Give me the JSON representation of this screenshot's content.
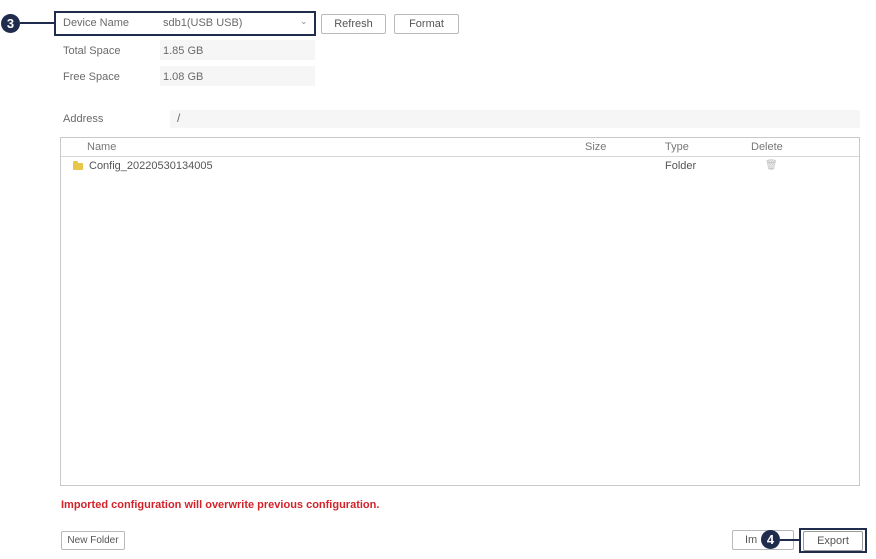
{
  "device": {
    "name_label": "Device Name",
    "name_value": "sdb1(USB USB)",
    "refresh_label": "Refresh",
    "format_label": "Format",
    "total_space_label": "Total Space",
    "total_space_value": "1.85 GB",
    "free_space_label": "Free Space",
    "free_space_value": "1.08 GB"
  },
  "address": {
    "label": "Address",
    "value": "/"
  },
  "table": {
    "headers": {
      "name": "Name",
      "size": "Size",
      "type": "Type",
      "delete": "Delete"
    },
    "rows": [
      {
        "name": "Config_20220530134005",
        "size": "",
        "type": "Folder"
      }
    ]
  },
  "warning": "Imported configuration will overwrite previous configuration.",
  "buttons": {
    "new_folder": "New Folder",
    "import": "Im",
    "export": "Export"
  },
  "callouts": {
    "device": "3",
    "export": "4"
  },
  "colors": {
    "callout": "#1f2c4d",
    "warning": "#d2232a",
    "folder": "#e8c64a"
  },
  "icons": {
    "folder": "folder-icon",
    "delete": "trash-icon",
    "dropdown": "chevron-down-icon"
  }
}
